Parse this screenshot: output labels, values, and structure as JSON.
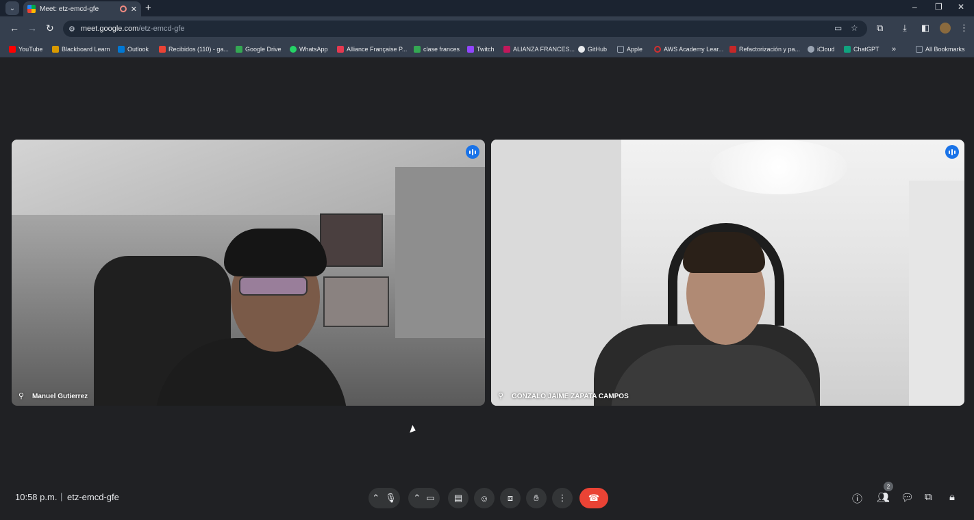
{
  "browser": {
    "tab_title": "Meet: etz-emcd-gfe",
    "url_host": "meet.google.com",
    "url_path": "/etz-emcd-gfe",
    "bookmarks": [
      {
        "label": "YouTube",
        "color": "#ff0000"
      },
      {
        "label": "Blackboard Learn",
        "color": "#d99a00"
      },
      {
        "label": "Outlook",
        "color": "#0078d4"
      },
      {
        "label": "Recibidos (110) - ga...",
        "color": "#ea4335"
      },
      {
        "label": "Google Drive",
        "color": "#34a853"
      },
      {
        "label": "WhatsApp",
        "color": "#25d366"
      },
      {
        "label": "Alliance Française P...",
        "color": "#e53950"
      },
      {
        "label": "clase frances",
        "color": "#34a853"
      },
      {
        "label": "Twitch",
        "color": "#9146ff"
      },
      {
        "label": "ALIANZA FRANCES...",
        "color": "#c2185b"
      },
      {
        "label": "GitHub",
        "color": "#e8eaed"
      },
      {
        "label": "Apple",
        "color": "#9aa4b2"
      },
      {
        "label": "AWS Academy Lear...",
        "color": "#d32f2f"
      },
      {
        "label": "Refactorización y pa...",
        "color": "#c62828"
      },
      {
        "label": "iCloud",
        "color": "#9aa4b2"
      },
      {
        "label": "ChatGPT",
        "color": "#10a37f"
      }
    ],
    "bookmarks_overflow": "»",
    "all_bookmarks": "All Bookmarks"
  },
  "meet": {
    "participants": [
      {
        "name": "Manuel Gutierrez"
      },
      {
        "name": "GONZALO JAIME ZAPATA CAMPOS"
      }
    ],
    "time": "10:58 p.m.",
    "meeting_code": "etz-emcd-gfe",
    "people_count": "2",
    "accent": "#1a73e8",
    "hangup_color": "#ea4335"
  }
}
